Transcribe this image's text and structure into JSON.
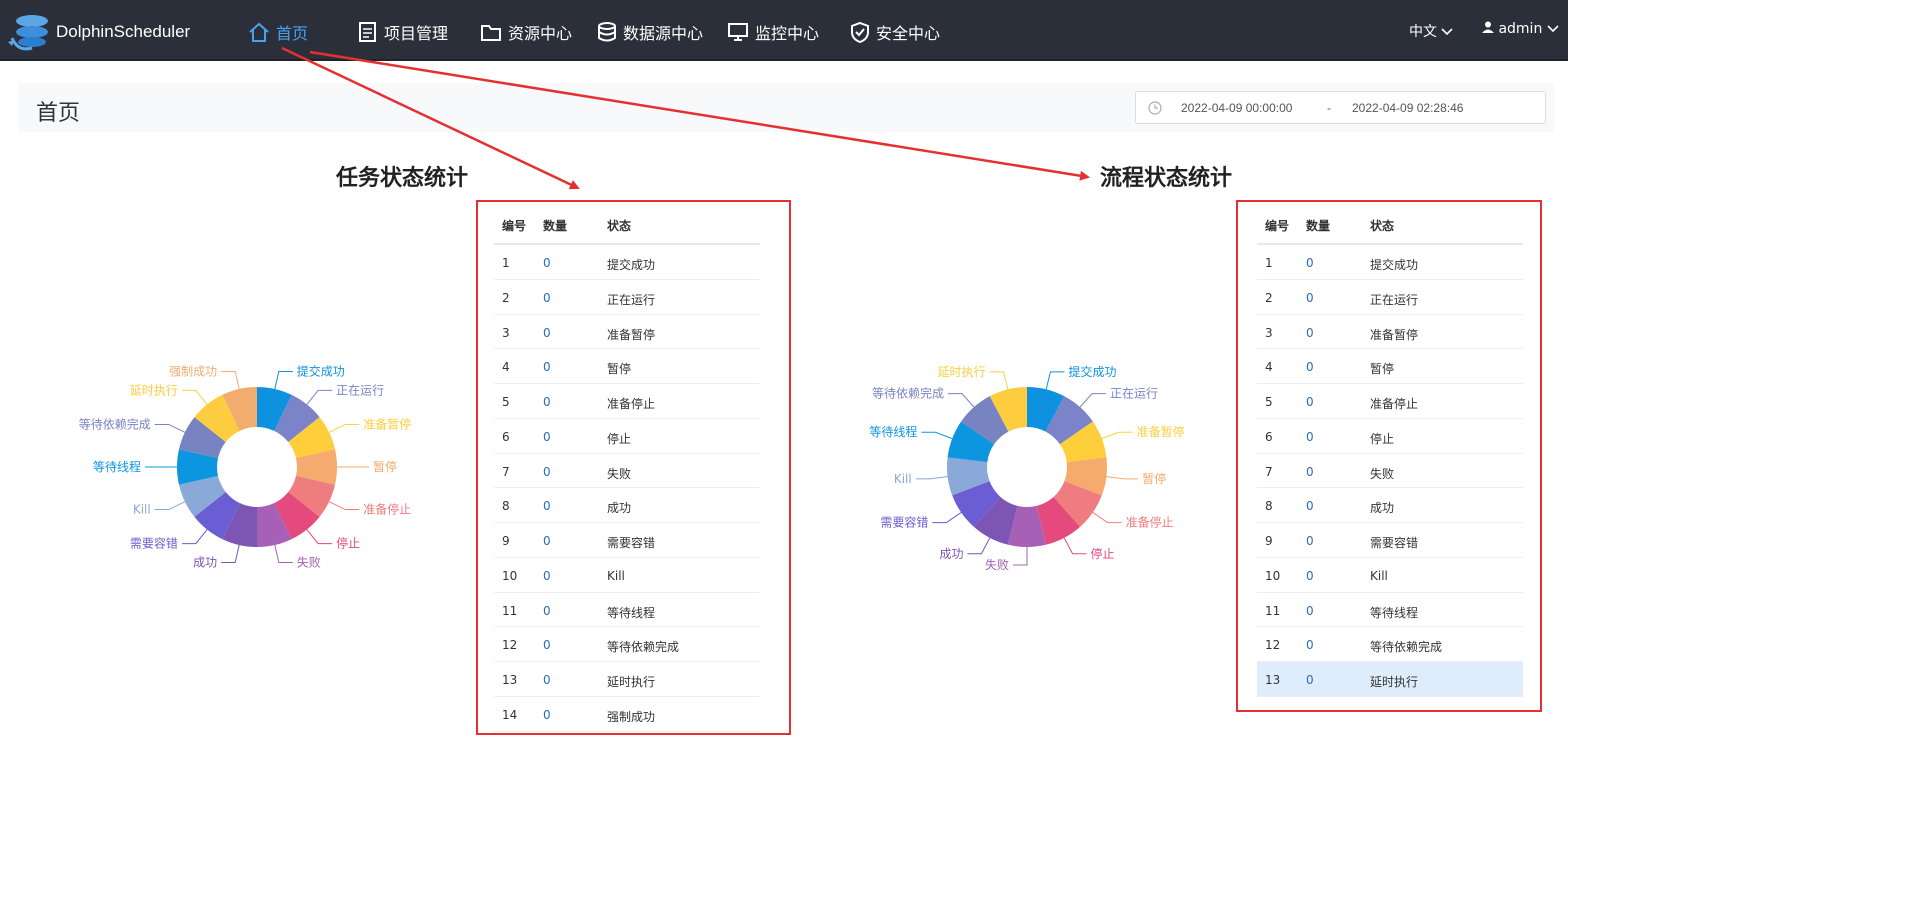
{
  "app": {
    "brand": "DolphinScheduler"
  },
  "nav": {
    "items": [
      {
        "label": "首页",
        "icon": "home-icon",
        "active": true
      },
      {
        "label": "项目管理",
        "icon": "document-icon"
      },
      {
        "label": "资源中心",
        "icon": "folder-icon"
      },
      {
        "label": "数据源中心",
        "icon": "database-icon"
      },
      {
        "label": "监控中心",
        "icon": "monitor-icon"
      },
      {
        "label": "安全中心",
        "icon": "shield-icon"
      }
    ],
    "language": "中文",
    "user": "admin"
  },
  "page": {
    "title": "首页",
    "date_start": "2022-04-09 00:00:00",
    "date_separator": "-",
    "date_end": "2022-04-09 02:28:46"
  },
  "task_stats": {
    "title": "任务状态统计",
    "headers": [
      "编号",
      "数量",
      "状态"
    ],
    "rows": [
      {
        "no": "1",
        "count": "0",
        "state": "提交成功"
      },
      {
        "no": "2",
        "count": "0",
        "state": "正在运行"
      },
      {
        "no": "3",
        "count": "0",
        "state": "准备暂停"
      },
      {
        "no": "4",
        "count": "0",
        "state": "暂停"
      },
      {
        "no": "5",
        "count": "0",
        "state": "准备停止"
      },
      {
        "no": "6",
        "count": "0",
        "state": "停止"
      },
      {
        "no": "7",
        "count": "0",
        "state": "失败"
      },
      {
        "no": "8",
        "count": "0",
        "state": "成功"
      },
      {
        "no": "9",
        "count": "0",
        "state": "需要容错"
      },
      {
        "no": "10",
        "count": "0",
        "state": "Kill"
      },
      {
        "no": "11",
        "count": "0",
        "state": "等待线程"
      },
      {
        "no": "12",
        "count": "0",
        "state": "等待依赖完成"
      },
      {
        "no": "13",
        "count": "0",
        "state": "延时执行"
      },
      {
        "no": "14",
        "count": "0",
        "state": "强制成功"
      }
    ]
  },
  "process_stats": {
    "title": "流程状态统计",
    "headers": [
      "编号",
      "数量",
      "状态"
    ],
    "highlighted_row": 13,
    "rows": [
      {
        "no": "1",
        "count": "0",
        "state": "提交成功"
      },
      {
        "no": "2",
        "count": "0",
        "state": "正在运行"
      },
      {
        "no": "3",
        "count": "0",
        "state": "准备暂停"
      },
      {
        "no": "4",
        "count": "0",
        "state": "暂停"
      },
      {
        "no": "5",
        "count": "0",
        "state": "准备停止"
      },
      {
        "no": "6",
        "count": "0",
        "state": "停止"
      },
      {
        "no": "7",
        "count": "0",
        "state": "失败"
      },
      {
        "no": "8",
        "count": "0",
        "state": "成功"
      },
      {
        "no": "9",
        "count": "0",
        "state": "需要容错"
      },
      {
        "no": "10",
        "count": "0",
        "state": "Kill"
      },
      {
        "no": "11",
        "count": "0",
        "state": "等待线程"
      },
      {
        "no": "12",
        "count": "0",
        "state": "等待依赖完成"
      },
      {
        "no": "13",
        "count": "0",
        "state": "延时执行"
      }
    ]
  },
  "chart_data": [
    {
      "type": "pie",
      "variant": "donut",
      "categories": [
        "提交成功",
        "正在运行",
        "准备暂停",
        "暂停",
        "准备停止",
        "停止",
        "失败",
        "成功",
        "需要容错",
        "Kill",
        "等待线程",
        "等待依赖完成",
        "延时执行",
        "强制成功"
      ],
      "values": [
        0,
        0,
        0,
        0,
        0,
        0,
        0,
        0,
        0,
        0,
        0,
        0,
        0,
        0
      ],
      "colors": [
        "#0e92e0",
        "#7b84c9",
        "#fecf3a",
        "#f5aa6e",
        "#ef7d7f",
        "#e44a7e",
        "#a660b5",
        "#7d55b5",
        "#6b5dd3",
        "#8aa8d8",
        "#0d96e0",
        "#7883c2",
        "#fecd3f",
        "#f2ac6d"
      ]
    },
    {
      "type": "pie",
      "variant": "donut",
      "categories": [
        "提交成功",
        "正在运行",
        "准备暂停",
        "暂停",
        "准备停止",
        "停止",
        "失败",
        "成功",
        "需要容错",
        "Kill",
        "等待线程",
        "等待依赖完成",
        "延时执行"
      ],
      "values": [
        0,
        0,
        0,
        0,
        0,
        0,
        0,
        0,
        0,
        0,
        0,
        0,
        0
      ],
      "colors": [
        "#0e92e0",
        "#7b84c9",
        "#fecf3a",
        "#f5aa6e",
        "#ef7d7f",
        "#e44a7e",
        "#a660b5",
        "#7d55b5",
        "#6b5dd3",
        "#8aa8d8",
        "#0d96e0",
        "#7883c2",
        "#fecd3f"
      ]
    }
  ]
}
